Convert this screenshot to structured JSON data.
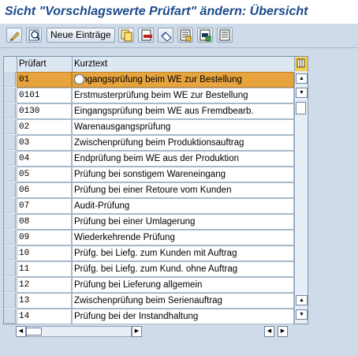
{
  "window": {
    "title": "Sicht \"Vorschlagswerte Prüfart\" ändern: Übersicht"
  },
  "toolbar": {
    "new_entries_label": "Neue Einträge",
    "icons": [
      "change-display-icon",
      "search-icon",
      "copy-icon",
      "delete-icon",
      "undo-icon",
      "select-all-icon",
      "select-block-icon",
      "deselect-all-icon"
    ]
  },
  "table": {
    "columns": [
      "Prüfart",
      "Kurztext"
    ],
    "rows": [
      {
        "code": "01",
        "text": "Eingangsprüfung beim WE zur Bestellung"
      },
      {
        "code": "0101",
        "text": "Erstmusterprüfung beim WE zur Bestellung"
      },
      {
        "code": "0130",
        "text": "Eingangsprüfung beim WE aus Fremdbearb."
      },
      {
        "code": "02",
        "text": "Warenausgangsprüfung"
      },
      {
        "code": "03",
        "text": "Zwischenprüfung beim Produktionsauftrag"
      },
      {
        "code": "04",
        "text": "Endprüfung beim WE aus der Produktion"
      },
      {
        "code": "05",
        "text": "Prüfung bei sonstigem Wareneingang"
      },
      {
        "code": "06",
        "text": "Prüfung bei einer Retoure vom Kunden"
      },
      {
        "code": "07",
        "text": "Audit-Prüfung"
      },
      {
        "code": "08",
        "text": "Prüfung bei einer Umlagerung"
      },
      {
        "code": "09",
        "text": "Wiederkehrende Prüfung"
      },
      {
        "code": "10",
        "text": "Prüfg. bei Liefg. zum Kunden mit Auftrag"
      },
      {
        "code": "11",
        "text": "Prüfg. bei Liefg. zum Kund. ohne Auftrag"
      },
      {
        "code": "12",
        "text": "Prüfung bei Lieferung allgemein"
      },
      {
        "code": "13",
        "text": "Zwischenprüfung beim Serienauftrag"
      },
      {
        "code": "14",
        "text": "Prüfung bei der Instandhaltung"
      }
    ],
    "active_row": 0
  },
  "colors": {
    "title": "#1b4a8a",
    "active_row": "#e6a33e",
    "background": "#cfdbe8"
  }
}
